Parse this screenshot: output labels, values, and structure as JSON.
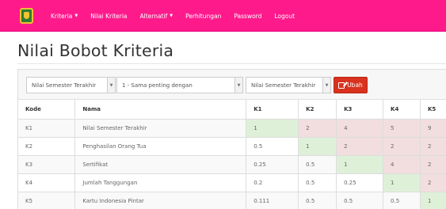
{
  "nav": {
    "items": [
      {
        "label": "Kriteria",
        "has_caret": true
      },
      {
        "label": "Nilai Kriteria",
        "has_caret": false
      },
      {
        "label": "Alternatif",
        "has_caret": true
      },
      {
        "label": "Perhitungan",
        "has_caret": false
      },
      {
        "label": "Password",
        "has_caret": false
      },
      {
        "label": "Logout",
        "has_caret": false
      }
    ],
    "caret": "▼"
  },
  "page": {
    "title": "Nilai Bobot Kriteria"
  },
  "form": {
    "select1_value": "Nilai Semester Terakhir",
    "select2_value": "1 - Sama penting dengan",
    "select3_value": "Nilai Semester Terakhir",
    "submit_label": "Ubah"
  },
  "table": {
    "headers": [
      "Kode",
      "Nama",
      "K1",
      "K2",
      "K3",
      "K4",
      "K5"
    ],
    "rows": [
      {
        "kode": "K1",
        "nama": "Nilai Semester Terakhir",
        "values": [
          "1",
          "2",
          "4",
          "5",
          "9"
        ]
      },
      {
        "kode": "K2",
        "nama": "Penghasilan Orang Tua",
        "values": [
          "0.5",
          "1",
          "2",
          "2",
          "2"
        ]
      },
      {
        "kode": "K3",
        "nama": "Sertifikat",
        "values": [
          "0.25",
          "0.5",
          "1",
          "4",
          "2"
        ]
      },
      {
        "kode": "K4",
        "nama": "Jumlah Tanggungan",
        "values": [
          "0.2",
          "0.5",
          "0.25",
          "1",
          "2"
        ]
      },
      {
        "kode": "K5",
        "nama": "Kartu Indonesia Pintar",
        "values": [
          "0.111",
          "0.5",
          "0.5",
          "0.5",
          "1"
        ]
      }
    ]
  },
  "colors": {
    "navbar": "#ff1a8c",
    "button": "#d9321e",
    "diagonal": "#dff0d8",
    "upper_triangle": "#f2dede"
  },
  "icons": {
    "logo": "app-logo-icon",
    "button": "edit-icon",
    "select_arrow": "chevron-down-icon"
  }
}
